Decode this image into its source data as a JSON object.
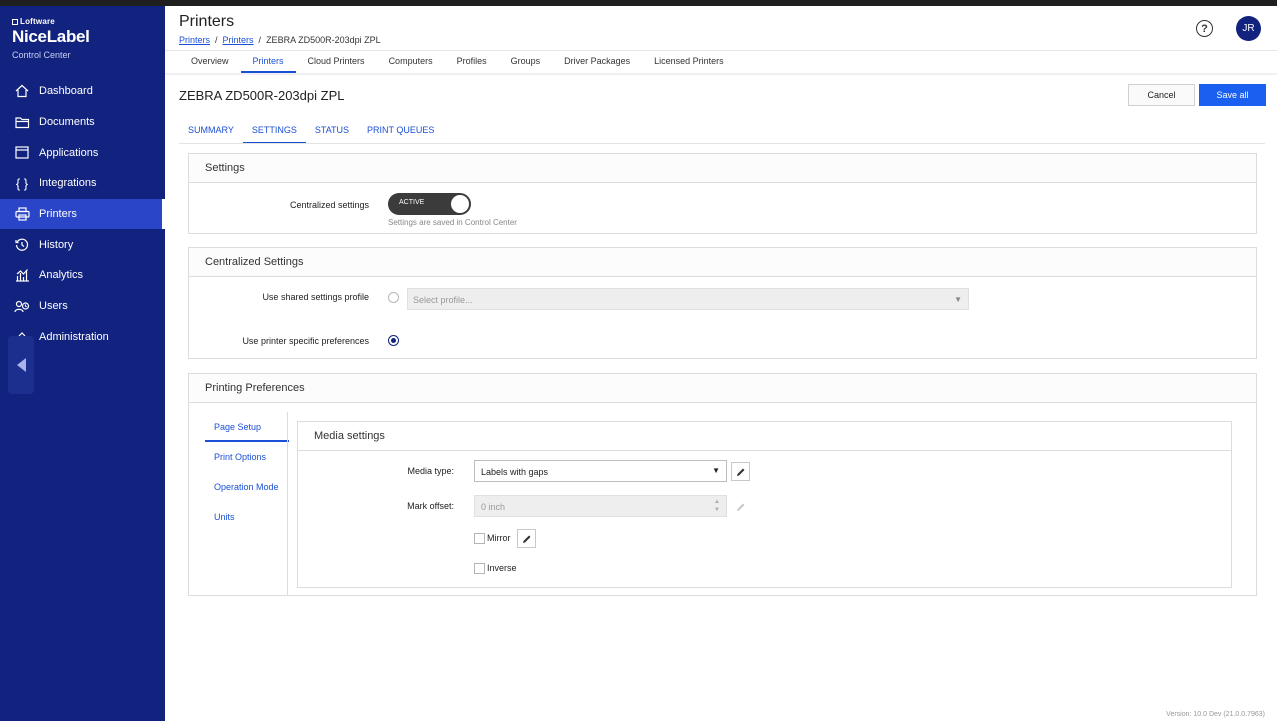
{
  "app": {
    "logo_small": "Loftware",
    "brand": "NiceLabel",
    "subtitle": "Control Center"
  },
  "sidebar": {
    "items": [
      {
        "label": "Dashboard",
        "icon": "home-icon"
      },
      {
        "label": "Documents",
        "icon": "folder-icon"
      },
      {
        "label": "Applications",
        "icon": "window-icon"
      },
      {
        "label": "Integrations",
        "icon": "braces-icon"
      },
      {
        "label": "Printers",
        "icon": "printer-icon"
      },
      {
        "label": "History",
        "icon": "history-icon"
      },
      {
        "label": "Analytics",
        "icon": "analytics-icon"
      },
      {
        "label": "Users",
        "icon": "users-icon"
      },
      {
        "label": "Administration",
        "icon": "admin-icon"
      }
    ],
    "active": "Printers"
  },
  "header": {
    "title": "Printers",
    "breadcrumb": [
      "Printers",
      "Printers",
      "ZEBRA ZD500R-203dpi ZPL"
    ],
    "avatar_initials": "JR",
    "help_glyph": "?"
  },
  "top_tabs": [
    "Overview",
    "Printers",
    "Cloud Printers",
    "Computers",
    "Profiles",
    "Groups",
    "Driver Packages",
    "Licensed Printers"
  ],
  "printer": {
    "name": "ZEBRA ZD500R-203dpi ZPL",
    "cancel_label": "Cancel",
    "save_label": "Save all"
  },
  "sub_tabs": [
    "SUMMARY",
    "SETTINGS",
    "STATUS",
    "PRINT QUEUES"
  ],
  "settings_panel": {
    "title": "Settings",
    "centralized_label": "Centralized settings",
    "toggle_text": "ACTIVE",
    "hint": "Settings are saved in Control Center"
  },
  "centralized_panel": {
    "title": "Centralized Settings",
    "shared_label": "Use shared settings profile",
    "select_placeholder": "Select profile...",
    "specific_label": "Use printer specific preferences"
  },
  "prefs_panel": {
    "title": "Printing Preferences",
    "nav": [
      "Page Setup",
      "Print Options",
      "Operation Mode",
      "Units"
    ],
    "media": {
      "title": "Media settings",
      "media_type_label": "Media type:",
      "media_type_value": "Labels with gaps",
      "mark_offset_label": "Mark offset:",
      "mark_offset_value": "0 inch",
      "mirror_label": "Mirror",
      "inverse_label": "Inverse"
    }
  },
  "version": "Version: 10.0 Dev (21.0.0.7963)",
  "colors": {
    "sidebar": "#12237f",
    "sidebar_active": "#2a45c7",
    "accent": "#1a4fd6",
    "save_button": "#1a5ff0"
  }
}
